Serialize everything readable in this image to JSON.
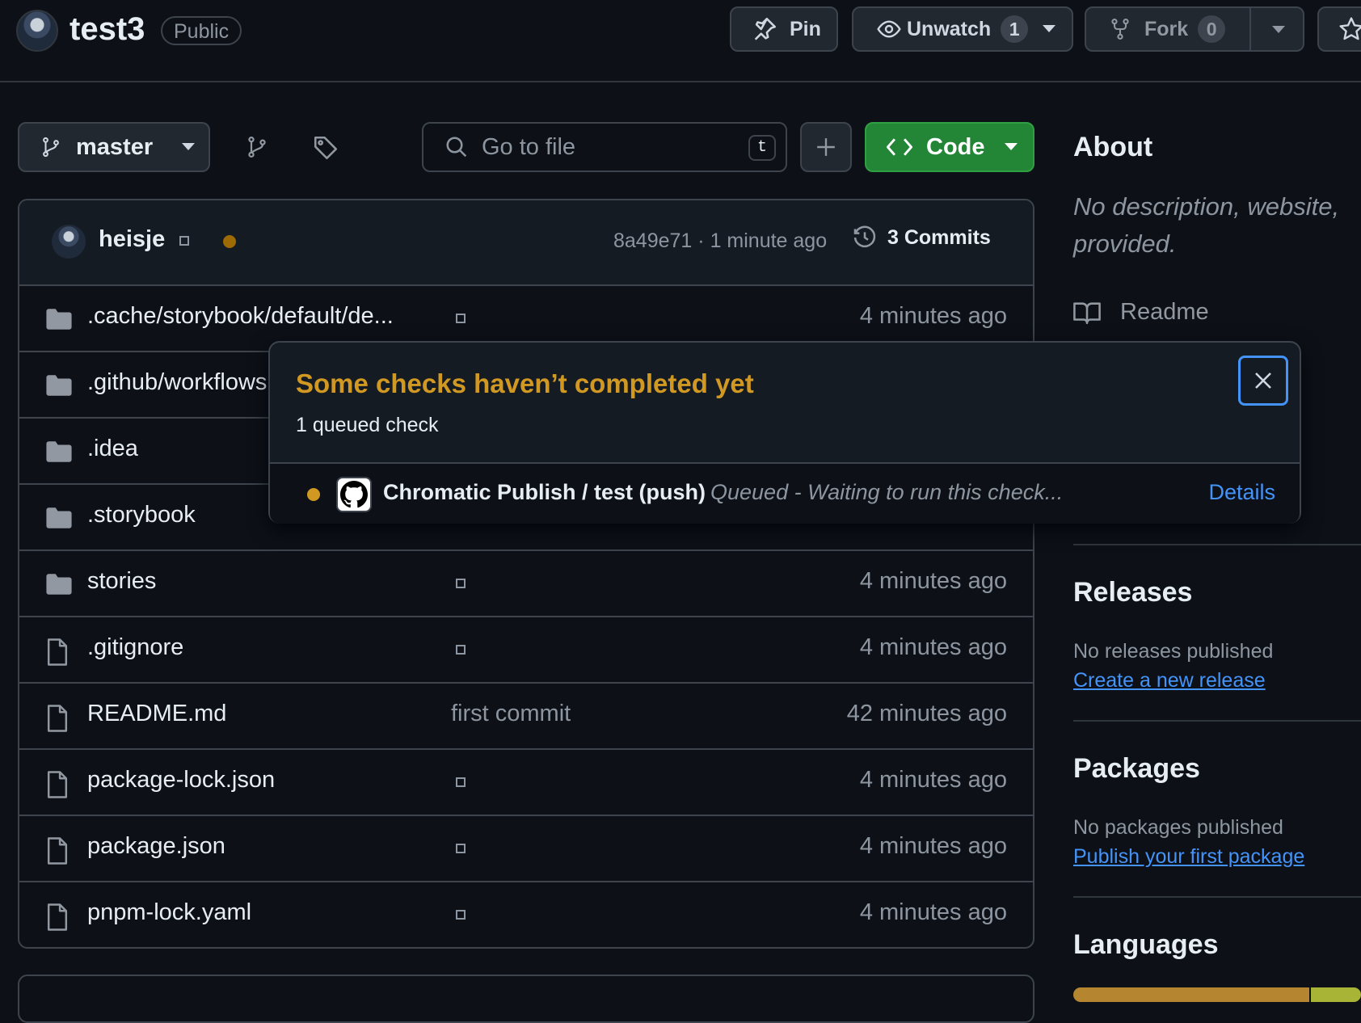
{
  "repo": {
    "name": "test3",
    "visibility": "Public"
  },
  "header_actions": {
    "pin_label": "Pin",
    "unwatch_label": "Unwatch",
    "watch_count": "1",
    "fork_label": "Fork",
    "fork_count": "0"
  },
  "toolbar": {
    "branch": "master",
    "search_placeholder": "Go to file",
    "search_shortcut": "t",
    "code_label": "Code"
  },
  "commit_bar": {
    "author": "heisje",
    "hash": "8a49e71",
    "separator": "·",
    "time": "1 minute ago",
    "commits_label": "3 Commits",
    "status_color": "#9e6a03"
  },
  "files": [
    {
      "type": "folder",
      "name": ".cache/storybook/default/de...",
      "message": "",
      "time": "4 minutes ago"
    },
    {
      "type": "folder",
      "name": ".github/workflows",
      "message": "",
      "time": ""
    },
    {
      "type": "folder",
      "name": ".idea",
      "message": "",
      "time": ""
    },
    {
      "type": "folder",
      "name": ".storybook",
      "message": "",
      "time": ""
    },
    {
      "type": "folder",
      "name": "stories",
      "message": "",
      "time": "4 minutes ago"
    },
    {
      "type": "file",
      "name": ".gitignore",
      "message": "",
      "time": "4 minutes ago"
    },
    {
      "type": "file",
      "name": "README.md",
      "message": "first commit",
      "time": "42 minutes ago"
    },
    {
      "type": "file",
      "name": "package-lock.json",
      "message": "",
      "time": "4 minutes ago"
    },
    {
      "type": "file",
      "name": "package.json",
      "message": "",
      "time": "4 minutes ago"
    },
    {
      "type": "file",
      "name": "pnpm-lock.yaml",
      "message": "",
      "time": "4 minutes ago"
    }
  ],
  "popover": {
    "title": "Some checks haven’t completed yet",
    "subtitle": "1 queued check",
    "check_name": "Chromatic Publish / test (push)",
    "check_status": "Queued - Waiting to run this check...",
    "details_label": "Details",
    "status_color": "#d29922"
  },
  "sidebar": {
    "about_title": "About",
    "about_desc_line1": "No description, website,",
    "about_desc_line2": "provided.",
    "readme_label": "Readme",
    "releases_title": "Releases",
    "releases_empty": "No releases published",
    "releases_link": "Create a new release",
    "packages_title": "Packages",
    "packages_empty": "No packages published",
    "packages_link": "Publish your first package",
    "languages_title": "Languages",
    "language_colors": [
      "#b5852f",
      "#a8b436"
    ]
  },
  "colors": {
    "accent_green": "#238636",
    "link_blue": "#4493f8",
    "warning": "#d29922"
  }
}
